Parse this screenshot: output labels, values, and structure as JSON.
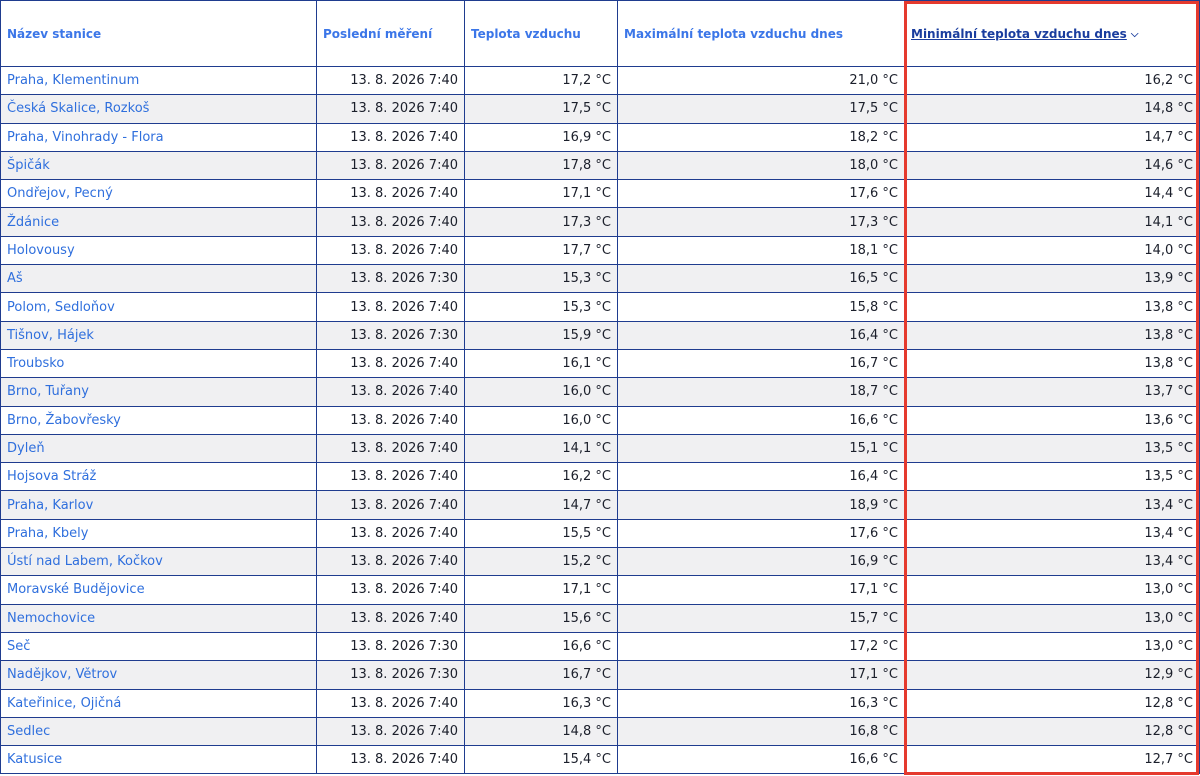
{
  "table": {
    "headers": [
      "Název stanice",
      "Poslední měření",
      "Teplota vzduchu",
      "Maximální teplota vzduchu dnes",
      "Minimální teplota vzduchu dnes"
    ],
    "sorted_column_index": 4,
    "sort_icon": "chevron-down-icon",
    "sort_icon_glyph": "⌵",
    "rows": [
      {
        "station": "Praha, Klementinum",
        "last": "13. 8. 2026 7:40",
        "temp": "17,2 °C",
        "max": "21,0 °C",
        "min": "16,2 °C"
      },
      {
        "station": "Česká Skalice, Rozkoš",
        "last": "13. 8. 2026 7:40",
        "temp": "17,5 °C",
        "max": "17,5 °C",
        "min": "14,8 °C"
      },
      {
        "station": "Praha, Vinohrady - Flora",
        "last": "13. 8. 2026 7:40",
        "temp": "16,9 °C",
        "max": "18,2 °C",
        "min": "14,7 °C"
      },
      {
        "station": "Špičák",
        "last": "13. 8. 2026 7:40",
        "temp": "17,8 °C",
        "max": "18,0 °C",
        "min": "14,6 °C"
      },
      {
        "station": "Ondřejov, Pecný",
        "last": "13. 8. 2026 7:40",
        "temp": "17,1 °C",
        "max": "17,6 °C",
        "min": "14,4 °C"
      },
      {
        "station": "Ždánice",
        "last": "13. 8. 2026 7:40",
        "temp": "17,3 °C",
        "max": "17,3 °C",
        "min": "14,1 °C"
      },
      {
        "station": "Holovousy",
        "last": "13. 8. 2026 7:40",
        "temp": "17,7 °C",
        "max": "18,1 °C",
        "min": "14,0 °C"
      },
      {
        "station": "Aš",
        "last": "13. 8. 2026 7:30",
        "temp": "15,3 °C",
        "max": "16,5 °C",
        "min": "13,9 °C"
      },
      {
        "station": "Polom, Sedloňov",
        "last": "13. 8. 2026 7:40",
        "temp": "15,3 °C",
        "max": "15,8 °C",
        "min": "13,8 °C"
      },
      {
        "station": "Tišnov, Hájek",
        "last": "13. 8. 2026 7:30",
        "temp": "15,9 °C",
        "max": "16,4 °C",
        "min": "13,8 °C"
      },
      {
        "station": "Troubsko",
        "last": "13. 8. 2026 7:40",
        "temp": "16,1 °C",
        "max": "16,7 °C",
        "min": "13,8 °C"
      },
      {
        "station": "Brno, Tuřany",
        "last": "13. 8. 2026 7:40",
        "temp": "16,0 °C",
        "max": "18,7 °C",
        "min": "13,7 °C"
      },
      {
        "station": "Brno, Žabovřesky",
        "last": "13. 8. 2026 7:40",
        "temp": "16,0 °C",
        "max": "16,6 °C",
        "min": "13,6 °C"
      },
      {
        "station": "Dyleň",
        "last": "13. 8. 2026 7:40",
        "temp": "14,1 °C",
        "max": "15,1 °C",
        "min": "13,5 °C"
      },
      {
        "station": "Hojsova Stráž",
        "last": "13. 8. 2026 7:40",
        "temp": "16,2 °C",
        "max": "16,4 °C",
        "min": "13,5 °C"
      },
      {
        "station": "Praha, Karlov",
        "last": "13. 8. 2026 7:40",
        "temp": "14,7 °C",
        "max": "18,9 °C",
        "min": "13,4 °C"
      },
      {
        "station": "Praha, Kbely",
        "last": "13. 8. 2026 7:40",
        "temp": "15,5 °C",
        "max": "17,6 °C",
        "min": "13,4 °C"
      },
      {
        "station": "Ústí nad Labem, Kočkov",
        "last": "13. 8. 2026 7:40",
        "temp": "15,2 °C",
        "max": "16,9 °C",
        "min": "13,4 °C"
      },
      {
        "station": "Moravské Budějovice",
        "last": "13. 8. 2026 7:40",
        "temp": "17,1 °C",
        "max": "17,1 °C",
        "min": "13,0 °C"
      },
      {
        "station": "Nemochovice",
        "last": "13. 8. 2026 7:40",
        "temp": "15,6 °C",
        "max": "15,7 °C",
        "min": "13,0 °C"
      },
      {
        "station": "Seč",
        "last": "13. 8. 2026 7:30",
        "temp": "16,6 °C",
        "max": "17,2 °C",
        "min": "13,0 °C"
      },
      {
        "station": "Nadějkov, Větrov",
        "last": "13. 8. 2026 7:30",
        "temp": "16,7 °C",
        "max": "17,1 °C",
        "min": "12,9 °C"
      },
      {
        "station": "Kateřinice, Ojičná",
        "last": "13. 8. 2026 7:40",
        "temp": "16,3 °C",
        "max": "16,3 °C",
        "min": "12,8 °C"
      },
      {
        "station": "Sedlec",
        "last": "13. 8. 2026 7:40",
        "temp": "14,8 °C",
        "max": "16,8 °C",
        "min": "12,8 °C"
      },
      {
        "station": "Katusice",
        "last": "13. 8. 2026 7:40",
        "temp": "15,4 °C",
        "max": "16,6 °C",
        "min": "12,7 °C"
      }
    ]
  },
  "colors": {
    "link": "#2f6fdd",
    "header_text": "#3b76e8",
    "sorted_header": "#1a3d9e",
    "border": "#1f3c8f",
    "zebra": "#f0f0f2",
    "highlight": "#e53a2e"
  }
}
